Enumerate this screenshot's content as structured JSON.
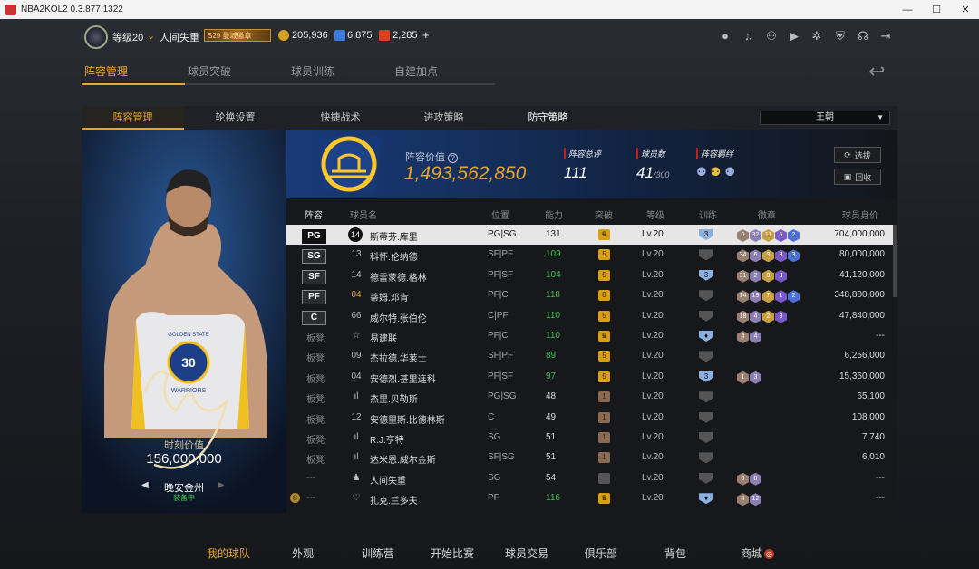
{
  "window": {
    "title": "NBA2KOL2 0.3.877.1322",
    "controls": [
      "—",
      "☐",
      "✕"
    ]
  },
  "player_bar": {
    "level": "等级20",
    "name": "人间失重",
    "rank_badge": "S29 曼城徽章",
    "currencies": [
      {
        "icon": "gold-coin-icon",
        "value": "205,936",
        "color": "#d4a020"
      },
      {
        "icon": "star-point-icon",
        "value": "6,875",
        "color": "#3a7ad8"
      },
      {
        "icon": "ticket-icon",
        "value": "2,285",
        "color": "#d84020"
      }
    ],
    "add": "+"
  },
  "top_icons": [
    "person-icon",
    "bell-icon",
    "friends-icon",
    "video-icon",
    "gear-icon",
    "shield-icon",
    "headset-icon",
    "exit-icon"
  ],
  "main_tabs": [
    "阵容管理",
    "球员突破",
    "球员训练",
    "自建加点"
  ],
  "sub_tabs": [
    "阵容管理",
    "轮换设置",
    "快捷战术",
    "进攻策略",
    "防守策略"
  ],
  "dynasty_select": "王朝",
  "card": {
    "value_label": "时刻价值",
    "value": "156,000,000",
    "player": "晚安金州",
    "status": "装备中",
    "number": "30",
    "team_text": "GOLDEN STATE",
    "team_text2": "WARRIORS"
  },
  "team": {
    "value_label": "阵容价值",
    "value": "1,493,562,850",
    "help": "?",
    "stats": [
      {
        "label": "阵容总评",
        "value": "111",
        "suffix": ""
      },
      {
        "label": "球员数",
        "value": "41",
        "suffix": "/300"
      },
      {
        "label": "阵容羁绊",
        "value": "",
        "suffix": ""
      }
    ],
    "buttons": [
      "选拔",
      "回收"
    ]
  },
  "columns": [
    "阵容",
    "球员名",
    "位置",
    "能力",
    "突破",
    "等级",
    "训练",
    "徽章",
    "球员身价"
  ],
  "rows": [
    {
      "slot": "PG",
      "num": "14",
      "name": "斯蒂芬.库里",
      "pos": "PG|SG",
      "ovr": "131",
      "brk": "♛",
      "lvl": "Lv.20",
      "train": "3",
      "badges": [
        "0",
        "32",
        "11",
        "5",
        "2"
      ],
      "price": "704,000,000",
      "sel": true,
      "ovr_color": "#111",
      "cap": ""
    },
    {
      "slot": "SG",
      "num": "13",
      "name": "科怀.伦纳德",
      "pos": "SF|PF",
      "ovr": "109",
      "brk": "5",
      "lvl": "Lv.20",
      "train": "",
      "badges": [
        "34",
        "6",
        "3",
        "3",
        "3"
      ],
      "price": "80,000,000",
      "ovr_color": "#3fbf50"
    },
    {
      "slot": "SF",
      "num": "14",
      "name": "德雷蒙德.格林",
      "pos": "PF|SF",
      "ovr": "104",
      "brk": "5",
      "lvl": "Lv.20",
      "train": "3",
      "badges": [
        "31",
        "2",
        "3",
        "3"
      ],
      "price": "41,120,000",
      "ovr_color": "#3fbf50"
    },
    {
      "slot": "PF",
      "num": "04",
      "name": "蒂姆.邓肯",
      "pos": "PF|C",
      "ovr": "118",
      "brk": "8",
      "lvl": "Lv.20",
      "train": "",
      "badges": [
        "14",
        "19",
        "7",
        "1",
        "2"
      ],
      "price": "348,800,000",
      "ovr_color": "#3fbf50",
      "gold": true
    },
    {
      "slot": "C",
      "num": "66",
      "name": "威尔特.张伯伦",
      "pos": "C|PF",
      "ovr": "110",
      "brk": "5",
      "lvl": "Lv.20",
      "train": "",
      "badges": [
        "18",
        "4",
        "2",
        "3"
      ],
      "price": "47,840,000",
      "ovr_color": "#3fbf50"
    },
    {
      "slot": "板凳",
      "num": "☆",
      "name": "易建联",
      "pos": "PF|C",
      "ovr": "110",
      "brk": "♛",
      "lvl": "Lv.20",
      "train": "♦",
      "badges": [
        "4",
        "4"
      ],
      "price": "---",
      "ovr_color": "#3fbf50"
    },
    {
      "slot": "板凳",
      "num": "09",
      "name": "杰拉德.华莱士",
      "pos": "SF|PF",
      "ovr": "89",
      "brk": "5",
      "lvl": "Lv.20",
      "train": "",
      "badges": [],
      "price": "6,256,000",
      "ovr_color": "#3fbf50"
    },
    {
      "slot": "板凳",
      "num": "04",
      "name": "安德烈.基里连科",
      "pos": "PF|SF",
      "ovr": "97",
      "brk": "5",
      "lvl": "Lv.20",
      "train": "3",
      "badges": [
        "1",
        "3"
      ],
      "price": "15,360,000",
      "ovr_color": "#3fbf50"
    },
    {
      "slot": "板凳",
      "num": "ıl",
      "name": "杰里.贝勒斯",
      "pos": "PG|SG",
      "ovr": "48",
      "brk": "1",
      "lvl": "Lv.20",
      "train": "",
      "badges": [],
      "price": "65,100",
      "ovr_color": "#ddd"
    },
    {
      "slot": "板凳",
      "num": "12",
      "name": "安德里斯.比德林斯",
      "pos": "C",
      "ovr": "49",
      "brk": "1",
      "lvl": "Lv.20",
      "train": "",
      "badges": [],
      "price": "108,000",
      "ovr_color": "#ddd"
    },
    {
      "slot": "板凳",
      "num": "ıl",
      "name": "R.J.亨特",
      "pos": "SG",
      "ovr": "51",
      "brk": "1",
      "lvl": "Lv.20",
      "train": "",
      "badges": [],
      "price": "7,740",
      "ovr_color": "#ddd"
    },
    {
      "slot": "板凳",
      "num": "ıl",
      "name": "达米恩.威尔金斯",
      "pos": "SF|SG",
      "ovr": "51",
      "brk": "1",
      "lvl": "Lv.20",
      "train": "",
      "badges": [],
      "price": "6,010",
      "ovr_color": "#ddd"
    },
    {
      "slot": "---",
      "num": "♟",
      "name": "人间失重",
      "pos": "SG",
      "ovr": "54",
      "brk": "",
      "lvl": "Lv.20",
      "train": "",
      "badges": [
        "0",
        "0"
      ],
      "price": "---",
      "ovr_color": "#ddd"
    },
    {
      "slot": "---",
      "num": "♡",
      "name": "扎克.兰多夫",
      "pos": "PF",
      "ovr": "116",
      "brk": "♛",
      "lvl": "Lv.20",
      "train": "♦",
      "badges": [
        "4",
        "12"
      ],
      "price": "---",
      "ovr_color": "#3fbf50",
      "cap": "◎"
    }
  ],
  "bottom_nav": [
    "我的球队",
    "外观",
    "训练营",
    "开始比赛",
    "球员交易",
    "俱乐部",
    "背包",
    "商城"
  ],
  "mall_badge": "◎"
}
